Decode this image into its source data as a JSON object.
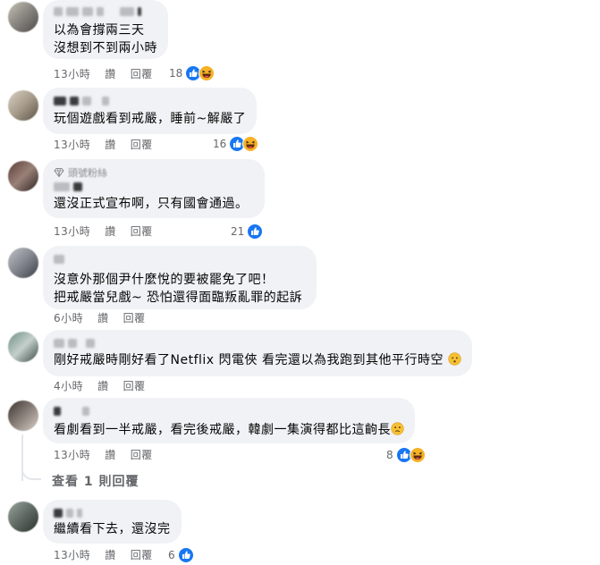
{
  "labels": {
    "like": "讚",
    "reply": "回覆"
  },
  "comments": [
    {
      "text": "以為會撐兩三天\n沒想到不到兩小時",
      "time": "13小時",
      "reaction_count": "18",
      "reactions": [
        "like-icon",
        "haha-icon"
      ]
    },
    {
      "text": "玩個遊戲看到戒嚴，睡前~解嚴了",
      "time": "13小時",
      "reaction_count": "16",
      "reactions": [
        "like-icon",
        "haha-icon"
      ]
    },
    {
      "badge": "頭號粉絲",
      "text": "還沒正式宣布啊，只有國會通過。",
      "time": "13小時",
      "reaction_count": "21",
      "reactions": [
        "like-icon"
      ]
    },
    {
      "text": "沒意外那個尹什麼悅的要被罷免了吧！\n把戒嚴當兒戲~ 恐怕還得面臨叛亂罪的起訴",
      "time": "6小時",
      "reaction_count": "",
      "reactions": []
    },
    {
      "text": "剛好戒嚴時剛好看了Netflix 閃電俠 看完還以為我跑到其他平行時空",
      "time": "4小時",
      "reaction_count": "",
      "reactions": []
    },
    {
      "text": "看劇看到一半戒嚴，看完後戒嚴，韓劇一集演得都比這齣長",
      "time": "13小時",
      "reaction_count": "8",
      "reactions": [
        "like-icon",
        "haha-icon"
      ]
    },
    {
      "text": "繼續看下去，還沒完",
      "time": "13小時",
      "reaction_count": "6",
      "reactions": [
        "like-icon"
      ]
    }
  ],
  "more_replies": "查看 1 則回覆",
  "colors": {
    "bubble": "#f0f2f5",
    "meta": "#65676b",
    "like": "#1877f2",
    "haha": "#f7b125"
  }
}
